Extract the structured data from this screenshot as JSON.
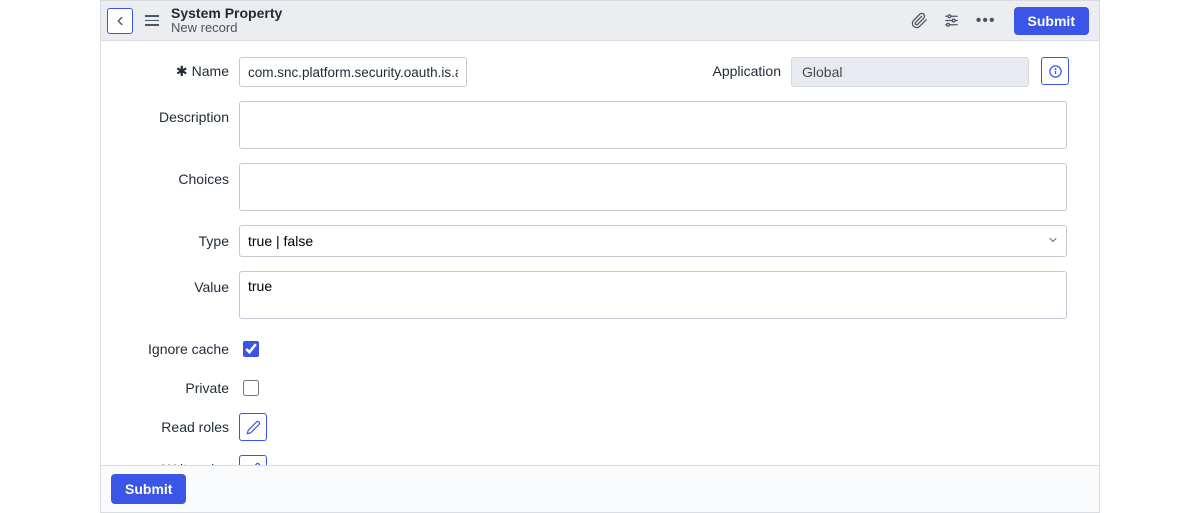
{
  "header": {
    "title": "System Property",
    "subtitle": "New record",
    "submit_label": "Submit"
  },
  "form": {
    "name": {
      "label": "Name",
      "value": "com.snc.platform.security.oauth.is.active"
    },
    "application": {
      "label": "Application",
      "value": "Global"
    },
    "description": {
      "label": "Description",
      "value": ""
    },
    "choices": {
      "label": "Choices",
      "value": ""
    },
    "type": {
      "label": "Type",
      "selected": "true | false"
    },
    "value": {
      "label": "Value",
      "value": "true"
    },
    "ignore_cache": {
      "label": "Ignore cache",
      "checked": true
    },
    "private": {
      "label": "Private",
      "checked": false
    },
    "read_roles": {
      "label": "Read roles"
    },
    "write_roles": {
      "label": "Write roles"
    }
  },
  "footer": {
    "submit_label": "Submit"
  }
}
